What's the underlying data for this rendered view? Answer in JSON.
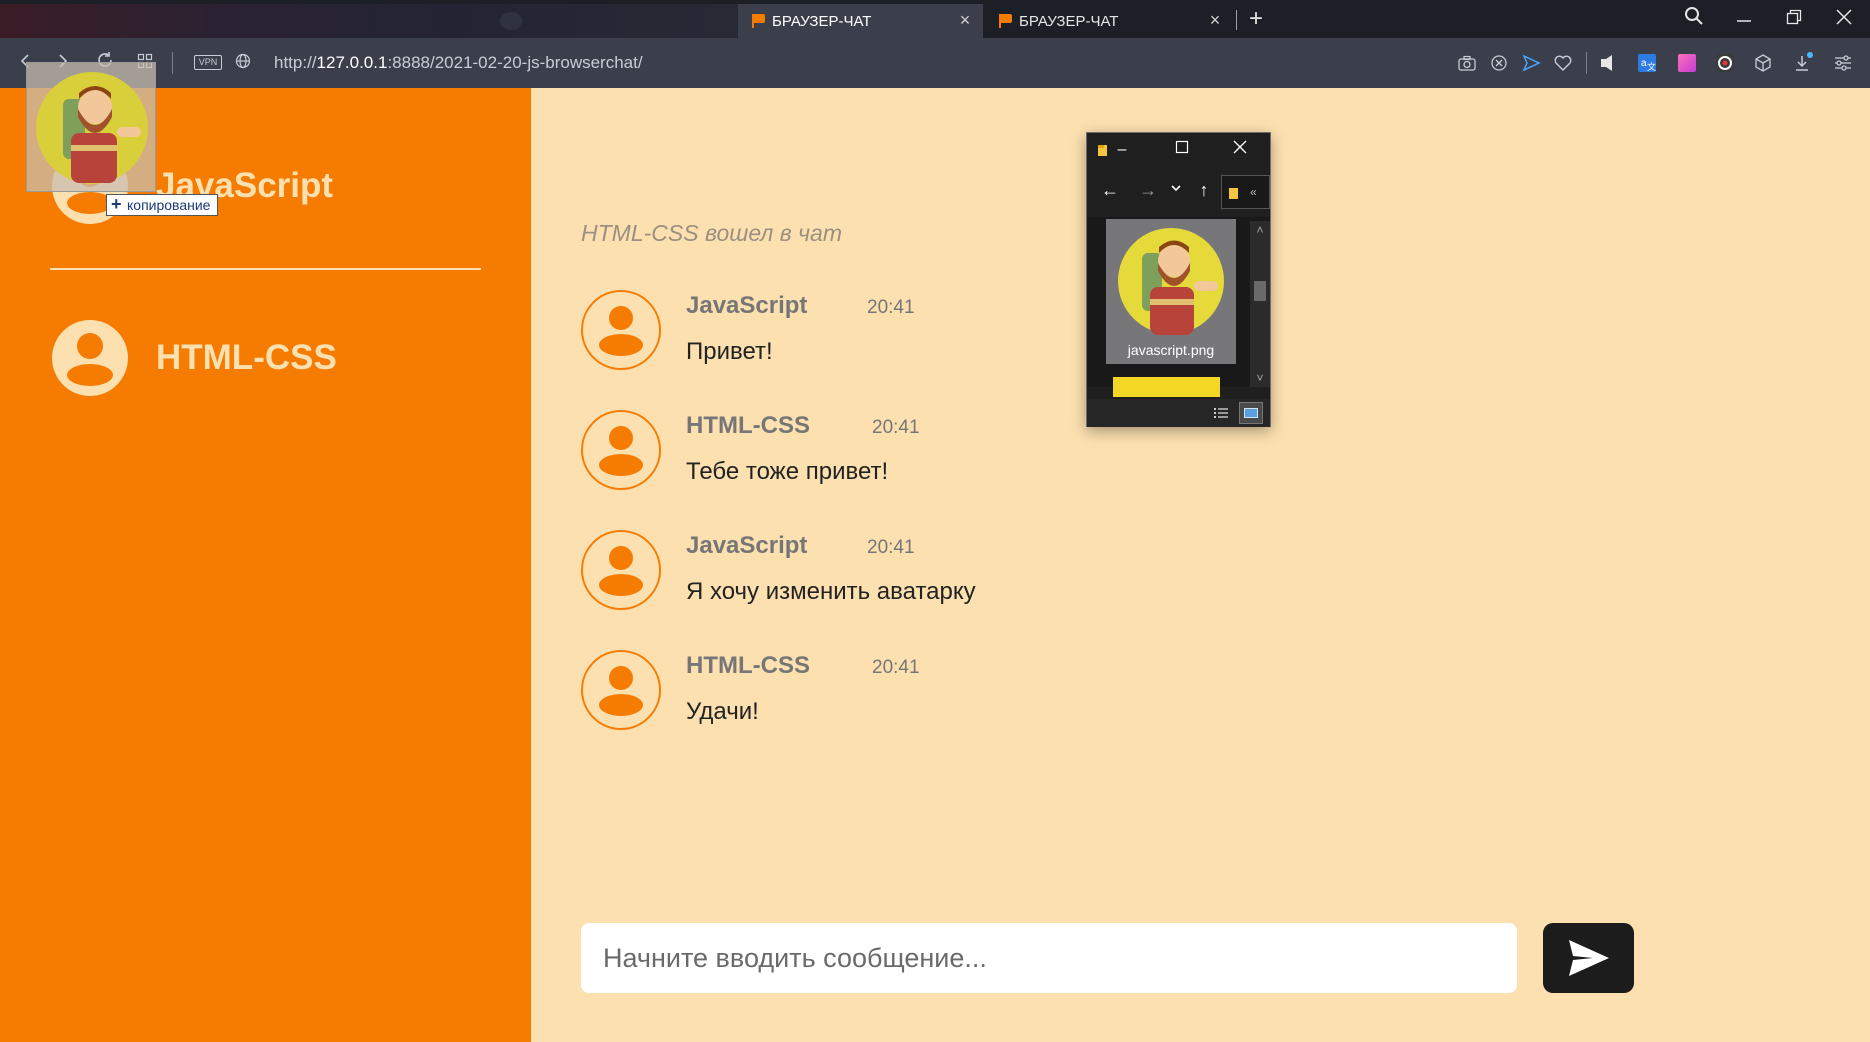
{
  "browser": {
    "tabs": [
      {
        "title": "БРАУЗЕР-ЧАТ",
        "active": true
      },
      {
        "title": "БРАУЗЕР-ЧАТ",
        "active": false
      }
    ],
    "vpn_label": "VPN",
    "url_host": "127.0.0.1",
    "url_prefix": "http://",
    "url_rest": ":8888/2021-02-20-js-browserchat/",
    "accent_color": "#f57c00"
  },
  "sidebar": {
    "current_user": "JavaScript",
    "contacts": [
      {
        "name": "HTML-CSS"
      }
    ],
    "drag_tooltip": "копирование"
  },
  "chat": {
    "system_message": "HTML-CSS вошел в чат",
    "messages": [
      {
        "author": "JavaScript",
        "time": "20:41",
        "text": "Привет!"
      },
      {
        "author": "HTML-CSS",
        "time": "20:41",
        "text": "Тебе тоже привет!"
      },
      {
        "author": "JavaScript",
        "time": "20:41",
        "text": "Я хочу изменить аватарку"
      },
      {
        "author": "HTML-CSS",
        "time": "20:41",
        "text": "Удачи!"
      }
    ],
    "composer_placeholder": "Начните вводить сообщение..."
  },
  "explorer": {
    "file_name": "javascript.png",
    "path_fragment": "«"
  },
  "colors": {
    "sidebar_bg": "#f57c00",
    "chat_bg": "#fde0b0",
    "send_button_bg": "#1c1c1c"
  }
}
